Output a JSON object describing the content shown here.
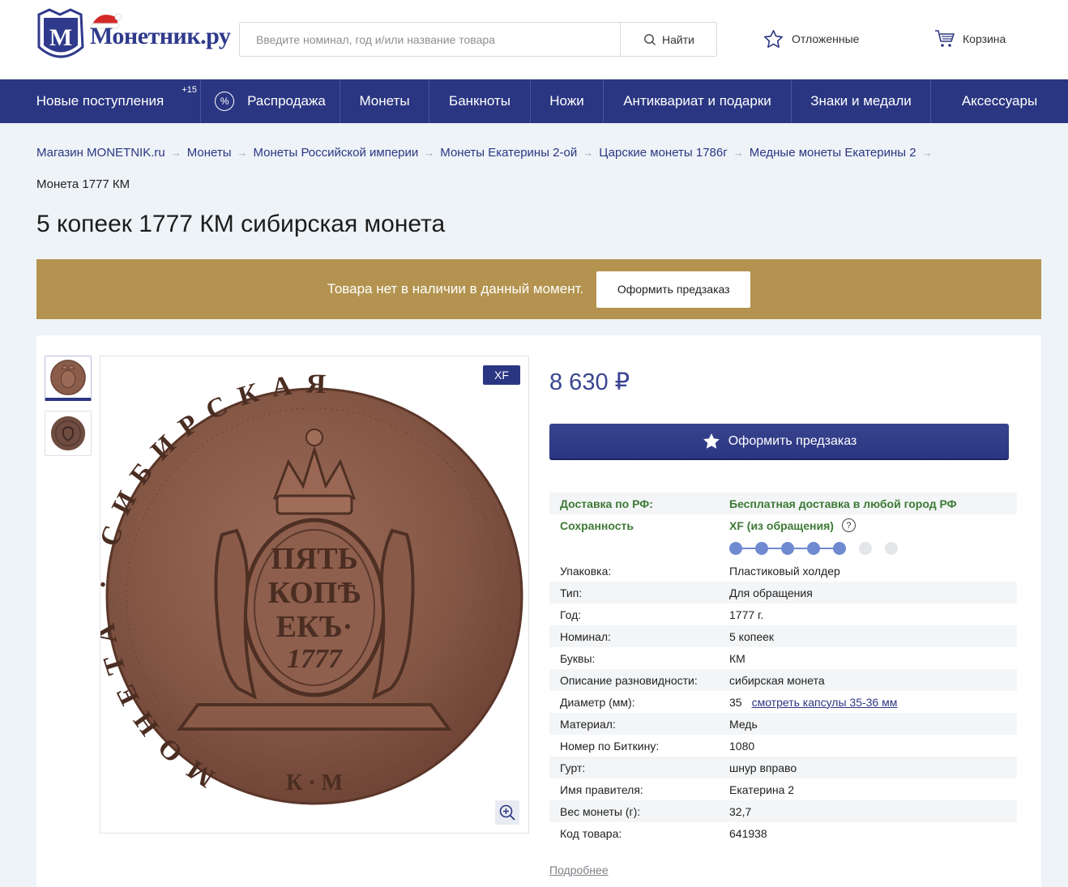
{
  "header": {
    "logo_text": "Монетник.ру",
    "search_placeholder": "Введите номинал, год и/или название товара",
    "search_button": "Найти",
    "favorites": "Отложенные",
    "cart": "Корзина"
  },
  "nav": [
    {
      "label": "Новые поступления",
      "badge": "+15"
    },
    {
      "label": "Распродажа",
      "icon": "percent-icon"
    },
    {
      "label": "Монеты"
    },
    {
      "label": "Банкноты"
    },
    {
      "label": "Ножи"
    },
    {
      "label": "Антиквариат и подарки"
    },
    {
      "label": "Знаки и медали"
    },
    {
      "label": "Аксессуары"
    }
  ],
  "breadcrumb": [
    "Магазин MONETNIK.ru",
    "Монеты",
    "Монеты Российской империи",
    "Монеты Екатерины 2-ой",
    "Царские монеты 1786г",
    "Медные монеты Екатерины 2"
  ],
  "breadcrumb_current": "Монета 1777 КМ",
  "title": "5 копеек 1777 КМ сибирская монета",
  "banner": {
    "text": "Товара нет в наличии в данный момент.",
    "button": "Оформить предзаказ"
  },
  "product": {
    "grade_badge": "XF",
    "price": "8 630 ₽",
    "preorder_button": "Оформить предзаказ",
    "condition_level": 5,
    "condition_max": 7,
    "specs_top": [
      {
        "key": "Доставка по РФ:",
        "value": "Бесплатная доставка в любой город РФ"
      },
      {
        "key": "Сохранность",
        "value": "XF (из обращения)",
        "help": "?"
      }
    ],
    "specs": [
      {
        "key": "Упаковка:",
        "value": "Пластиковый холдер"
      },
      {
        "key": "Тип:",
        "value": "Для обращения"
      },
      {
        "key": "Год:",
        "value": "1777 г."
      },
      {
        "key": "Номинал:",
        "value": "5 копеек"
      },
      {
        "key": "Буквы:",
        "value": "КМ"
      },
      {
        "key": "Описание разновидности:",
        "value": "сибирская монета"
      },
      {
        "key": "Диаметр (мм):",
        "value": "35",
        "link": "смотреть капсулы 35-36 мм"
      },
      {
        "key": "Материал:",
        "value": "Медь"
      },
      {
        "key": "Номер по Биткину:",
        "value": "1080"
      },
      {
        "key": "Гурт:",
        "value": "шнур вправо"
      },
      {
        "key": "Имя правителя:",
        "value": "Екатерина 2"
      },
      {
        "key": "Вес монеты (г):",
        "value": "32,7"
      },
      {
        "key": "Код товара:",
        "value": "641938"
      }
    ],
    "more_link": "Подробнее"
  },
  "coin_inscriptions": {
    "center": [
      "ПЯТЬ",
      "КОПѢ",
      "ЕКЪ·",
      "1777"
    ],
    "ring": "МОНЕТА · СИБИРСКАЯ",
    "mint": "К · М"
  },
  "colors": {
    "brand": "#2b3682",
    "banner": "#b3934f",
    "green": "#3d7a35"
  }
}
